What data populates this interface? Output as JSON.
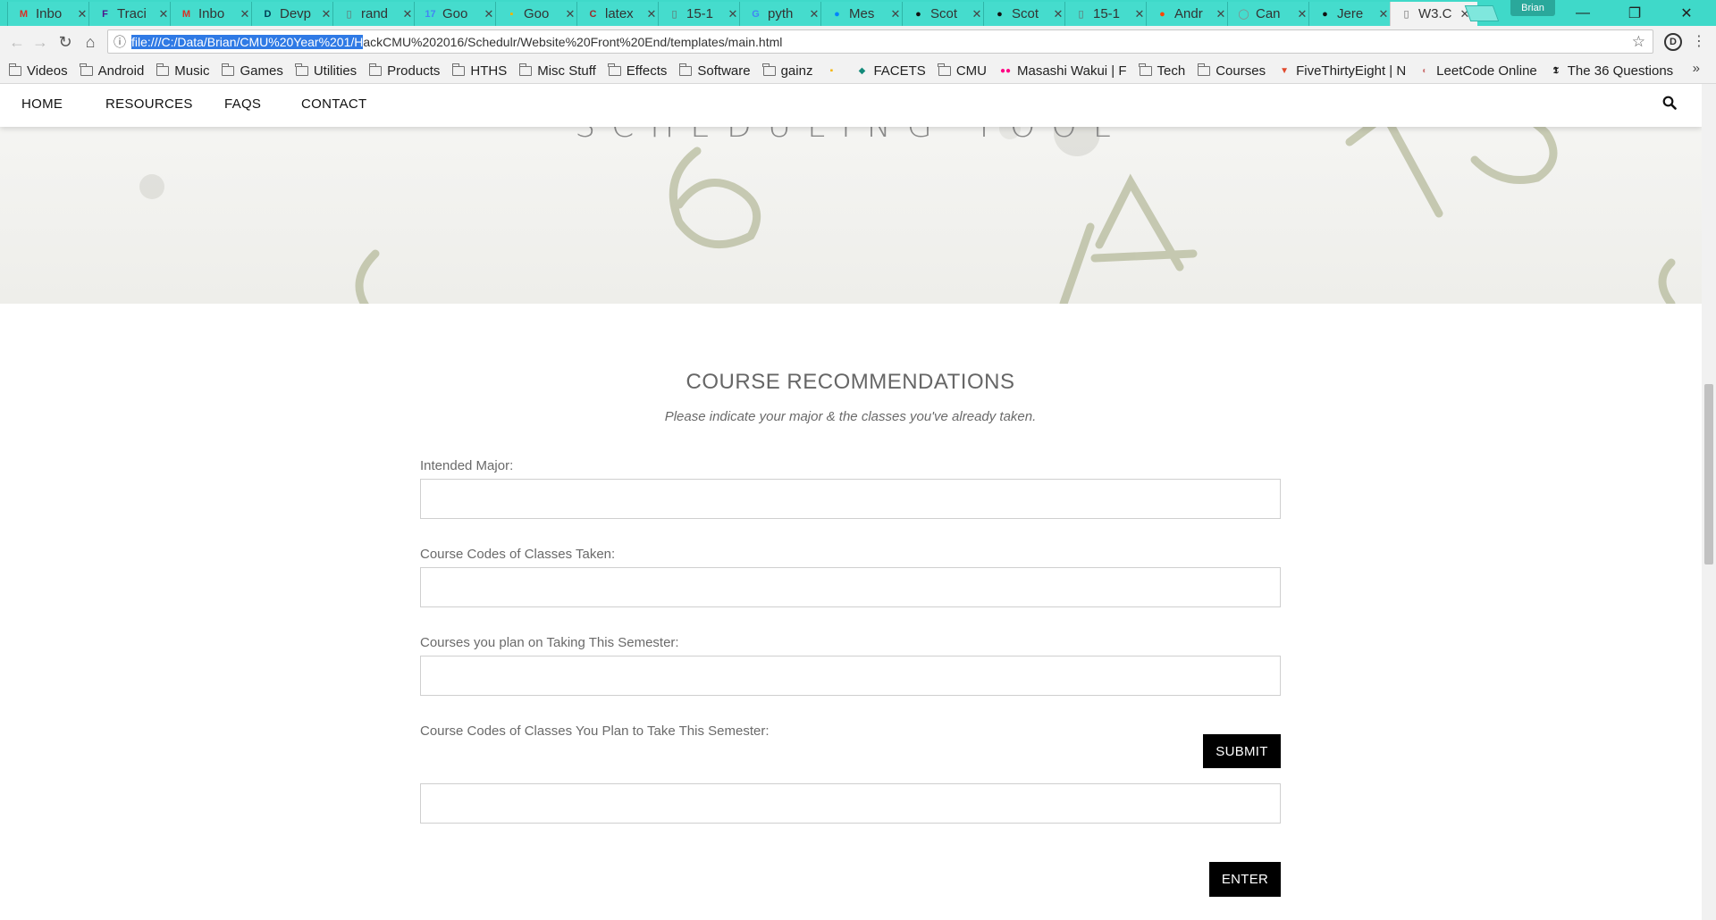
{
  "browser": {
    "tabs": [
      {
        "label": "Inbo",
        "icon": "gmail-icon",
        "icon_char": "M",
        "icon_color": "#d93025"
      },
      {
        "label": "Traci",
        "icon": "fedex-icon",
        "icon_char": "F",
        "icon_color": "#4d148c"
      },
      {
        "label": "Inbo",
        "icon": "gmail-icon",
        "icon_char": "M",
        "icon_color": "#d93025"
      },
      {
        "label": "Devp",
        "icon": "devpost-icon",
        "icon_char": "D",
        "icon_color": "#003e54"
      },
      {
        "label": "rand",
        "icon": "page-icon",
        "icon_char": "▯",
        "icon_color": "#666666"
      },
      {
        "label": "Goo",
        "icon": "google-calendar-icon",
        "icon_char": "17",
        "icon_color": "#4285f4"
      },
      {
        "label": "Goo",
        "icon": "google-keep-icon",
        "icon_char": "▪",
        "icon_color": "#f4b400"
      },
      {
        "label": "latex",
        "icon": "c-icon",
        "icon_char": "C",
        "icon_color": "#9c2a2a"
      },
      {
        "label": "15-1",
        "icon": "page-icon",
        "icon_char": "▯",
        "icon_color": "#666666"
      },
      {
        "label": "pyth",
        "icon": "google-icon",
        "icon_char": "G",
        "icon_color": "#4285f4"
      },
      {
        "label": "Mes",
        "icon": "messenger-icon",
        "icon_char": "●",
        "icon_color": "#0084ff"
      },
      {
        "label": "Scot",
        "icon": "github-icon",
        "icon_char": "●",
        "icon_color": "#111111"
      },
      {
        "label": "Scot",
        "icon": "github-icon",
        "icon_char": "●",
        "icon_color": "#111111"
      },
      {
        "label": "15-1",
        "icon": "page-icon",
        "icon_char": "▯",
        "icon_color": "#666666"
      },
      {
        "label": "Andr",
        "icon": "reddit-icon",
        "icon_char": "●",
        "icon_color": "#ff4500"
      },
      {
        "label": "Can",
        "icon": "page-icon",
        "icon_char": "◯",
        "icon_color": "#888888"
      },
      {
        "label": "Jere",
        "icon": "github-icon",
        "icon_char": "●",
        "icon_color": "#111111"
      },
      {
        "label": "W3.C",
        "icon": "page-icon",
        "icon_char": "▯",
        "icon_color": "#666666",
        "active": true
      }
    ],
    "profile_name": "Brian",
    "url_selected": "file:///C:/Data/Brian/CMU%20Year%201/H",
    "url_rest": "ackCMU%202016/Schedulr/Website%20Front%20End/templates/main.html",
    "bookmarks": [
      {
        "label": "Videos",
        "type": "folder"
      },
      {
        "label": "Android",
        "type": "folder"
      },
      {
        "label": "Music",
        "type": "folder"
      },
      {
        "label": "Games",
        "type": "folder"
      },
      {
        "label": "Utilities",
        "type": "folder"
      },
      {
        "label": "Products",
        "type": "folder"
      },
      {
        "label": "HTHS",
        "type": "folder"
      },
      {
        "label": "Misc Stuff",
        "type": "folder"
      },
      {
        "label": "Effects",
        "type": "folder"
      },
      {
        "label": "Software",
        "type": "folder"
      },
      {
        "label": "gainz",
        "type": "folder"
      },
      {
        "label": "",
        "type": "site",
        "icon_char": "▪",
        "icon_color": "#f4b400"
      },
      {
        "label": "FACETS",
        "type": "site",
        "icon_char": "◆",
        "icon_color": "#138a7a"
      },
      {
        "label": "CMU",
        "type": "folder"
      },
      {
        "label": "Masashi Wakui | F",
        "type": "site",
        "icon_char": "●●",
        "icon_color": "#ff0084"
      },
      {
        "label": "Tech",
        "type": "folder"
      },
      {
        "label": "Courses",
        "type": "folder"
      },
      {
        "label": "FiveThirtyEight | N",
        "type": "site",
        "icon_char": "▼",
        "icon_color": "#e0492c"
      },
      {
        "label": "LeetCode Online",
        "type": "site",
        "icon_char": "◐",
        "icon_color": "#c77"
      },
      {
        "label": "The 36 Questions",
        "type": "site",
        "icon_char": "𝕿",
        "icon_color": "#111"
      }
    ]
  },
  "site": {
    "nav": [
      "HOME",
      "RESOURCES",
      "FAQS",
      "CONTACT"
    ],
    "hero_title": "SCHEDULING TOOL",
    "section_title": "COURSE RECOMMENDATIONS",
    "section_subtitle": "Please indicate your major & the classes you've already taken.",
    "fields": {
      "major_label": "Intended Major:",
      "taken_label": "Course Codes of Classes Taken:",
      "plan_label": "Courses you plan on Taking This Semester:",
      "plan_codes_label": "Course Codes of Classes You Plan to Take This Semester:"
    },
    "submit_label": "SUBMIT",
    "enter_label": "ENTER"
  }
}
